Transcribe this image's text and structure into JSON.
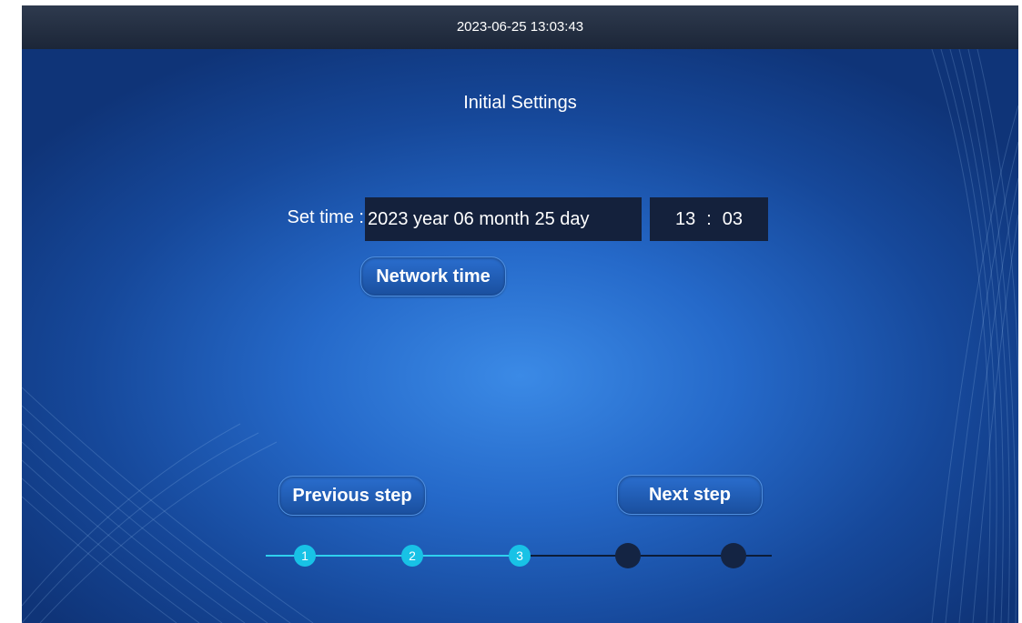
{
  "status_bar": {
    "datetime": "2023-06-25 13:03:43"
  },
  "page": {
    "title": "Initial Settings"
  },
  "set_time": {
    "label": "Set time :",
    "date": "2023 year 06 month 25 day",
    "hour": "13",
    "separator": ":",
    "minute": "03",
    "network_time_label": "Network time"
  },
  "navigation": {
    "previous_label": "Previous step",
    "next_label": "Next step"
  },
  "progress": {
    "current_step": 3,
    "total_steps": 5,
    "steps": [
      {
        "label": "1",
        "completed": true
      },
      {
        "label": "2",
        "completed": true
      },
      {
        "label": "3",
        "completed": true
      },
      {
        "label": "",
        "completed": false
      },
      {
        "label": "",
        "completed": false
      }
    ]
  },
  "colors": {
    "background": "#2569c9",
    "top_bar": "#263247",
    "field": "#14213c",
    "step_done": "#18c2e6",
    "step_todo": "#142443"
  }
}
